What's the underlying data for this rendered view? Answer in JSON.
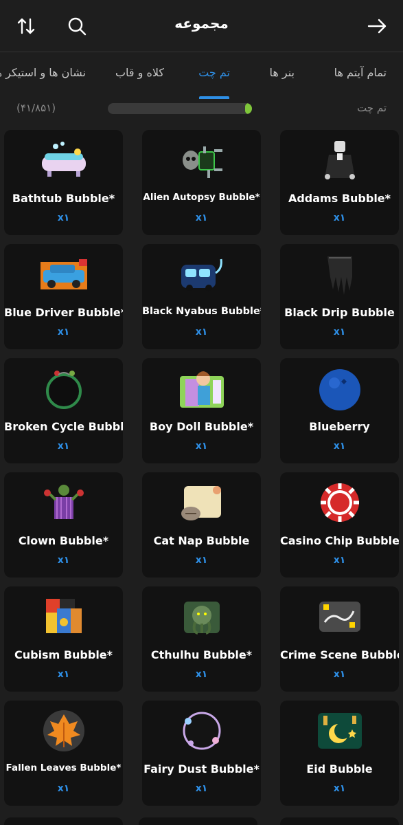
{
  "header": {
    "title": "مجموعه",
    "sort_icon": "sort-arrows-icon",
    "search_icon": "search-icon",
    "back_icon": "arrow-right-icon"
  },
  "tabs": [
    {
      "label": "تمام آیتم ها"
    },
    {
      "label": "بنر ها"
    },
    {
      "label": "تم چت"
    },
    {
      "label": "کلاه و قاب"
    },
    {
      "label": "نشان ها و استیکر ها"
    }
  ],
  "active_tab": "تم چت",
  "progress": {
    "label": "تم چت",
    "count": "(۴۱/۸۵۱)",
    "fraction": 0.048,
    "color": "#7fc63a"
  },
  "accent_color": "#2e8fe6",
  "items": [
    {
      "name": "Bathtub Bubble*",
      "qty": "x۱",
      "icon": "bathtub"
    },
    {
      "name": "Alien Autopsy Bubble*",
      "qty": "x۱",
      "icon": "alien"
    },
    {
      "name": "Addams Bubble*",
      "qty": "x۱",
      "icon": "addams"
    },
    {
      "name": "Blue Driver Bubble*",
      "qty": "x۱",
      "icon": "car"
    },
    {
      "name": "Black Nyabus Bubble*",
      "qty": "x۱",
      "icon": "bus"
    },
    {
      "name": "Black Drip Bubble",
      "qty": "x۱",
      "icon": "drip"
    },
    {
      "name": "Broken Cycle Bubble",
      "qty": "x۱",
      "icon": "ring"
    },
    {
      "name": "Boy Doll Bubble*",
      "qty": "x۱",
      "icon": "doll"
    },
    {
      "name": "Blueberry",
      "qty": "x۱",
      "icon": "blueberry"
    },
    {
      "name": "Clown Bubble*",
      "qty": "x۱",
      "icon": "clown"
    },
    {
      "name": "Cat Nap Bubble",
      "qty": "x۱",
      "icon": "scroll"
    },
    {
      "name": "Casino Chip Bubble*",
      "qty": "x۱",
      "icon": "chip"
    },
    {
      "name": "Cubism Bubble*",
      "qty": "x۱",
      "icon": "cubism"
    },
    {
      "name": "Cthulhu Bubble*",
      "qty": "x۱",
      "icon": "cthulhu"
    },
    {
      "name": "Crime Scene Bubble*",
      "qty": "x۱",
      "icon": "crime"
    },
    {
      "name": "Fallen Leaves Bubble*",
      "qty": "x۱",
      "icon": "leaf"
    },
    {
      "name": "Fairy Dust Bubble*",
      "qty": "x۱",
      "icon": "fairy"
    },
    {
      "name": "Eid Bubble",
      "qty": "x۱",
      "icon": "eid"
    }
  ]
}
